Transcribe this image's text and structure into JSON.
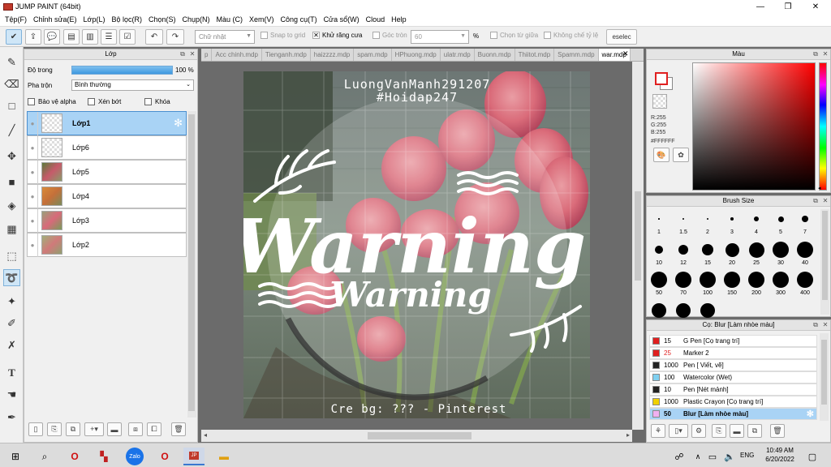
{
  "window": {
    "title": "JUMP PAINT (64bit)"
  },
  "menu": [
    "Tệp(F)",
    "Chỉnh sửa(E)",
    "Lớp(L)",
    "Bộ lọc(R)",
    "Chọn(S)",
    "Chụp(N)",
    "Màu (C)",
    "Xem(V)",
    "Công cụ(T)",
    "Cửa sổ(W)",
    "Cloud",
    "Help"
  ],
  "toolbar": {
    "shape_select": "Chữ nhật",
    "snap_grid": "Snap to grid",
    "antialias": "Khử răng cưa",
    "corner_label": "Góc tròn",
    "corner_value": "60",
    "percent": "%",
    "select_center": "Chọn từ giữa",
    "lock_ratio": "Không chế tỷ lệ",
    "deselect": "eselec"
  },
  "layers": {
    "title": "Lớp",
    "opacity_label": "Độ trong",
    "opacity_value": "100 %",
    "opacity": 1.0,
    "blend_label": "Pha trộn",
    "blend_value": "Bình thường",
    "protect_alpha": "Bảo vệ alpha",
    "clip": "Xén bớt",
    "lock": "Khóa",
    "items": [
      {
        "name": "Lớp1",
        "selected": true
      },
      {
        "name": "Lớp6",
        "selected": false
      },
      {
        "name": "Lớp5",
        "selected": false
      },
      {
        "name": "Lớp4",
        "selected": false
      },
      {
        "name": "Lớp3",
        "selected": false
      },
      {
        "name": "Lớp2",
        "selected": false
      }
    ]
  },
  "tabs": [
    "p",
    "Acc chinh.mdp",
    "Tienganh.mdp",
    "haizzzz.mdp",
    "spam.mdp",
    "HPhuong.mdp",
    "ulatr.mdp",
    "Buonn.mdp",
    "Thiitot.mdp",
    "Spamm.mdp",
    "war.mdp"
  ],
  "artwork": {
    "line1": "LuongVanManh291207",
    "line2": "#Hoidap247",
    "big": "Warning",
    "small": "Warning",
    "credit": "Cre bg: ??? - Pinterest"
  },
  "color": {
    "title": "Màu",
    "r": "R:255",
    "g": "G:255",
    "b": "B:255",
    "hex": "#FFFFFF",
    "fg": "#ffffff",
    "bg": "#ffffff",
    "accent": "#e02020"
  },
  "brush_size": {
    "title": "Brush Size",
    "sizes": [
      "1",
      "1.5",
      "2",
      "3",
      "4",
      "5",
      "7",
      "10",
      "12",
      "15",
      "20",
      "25",
      "30",
      "40",
      "50",
      "70",
      "100",
      "150",
      "200",
      "300",
      "400",
      "",
      "",
      ""
    ]
  },
  "tool_options": {
    "title": "Cọ: Blur [Làm nhòe màu]",
    "brushes": [
      {
        "size": "15",
        "name": "G Pen [Cọ trang trí]",
        "color": "#e02020",
        "size_red": false,
        "selected": false
      },
      {
        "size": "25",
        "name": "Marker 2",
        "color": "#e02020",
        "size_red": true,
        "selected": false
      },
      {
        "size": "1000",
        "name": "Pen [ Viết, vẽ]",
        "color": "#222222",
        "size_red": false,
        "selected": false
      },
      {
        "size": "100",
        "name": "Watercolor (Wet)",
        "color": "#7fd0f0",
        "size_red": false,
        "selected": false
      },
      {
        "size": "10",
        "name": "Pen [Nét mảnh]",
        "color": "#222222",
        "size_red": false,
        "selected": false
      },
      {
        "size": "1000",
        "name": "Plastic Crayon [Cọ trang trí]",
        "color": "#f0d000",
        "size_red": false,
        "selected": false
      },
      {
        "size": "50",
        "name": "Blur [Làm nhòe màu]",
        "color": "#f0b0f0",
        "size_red": false,
        "selected": true
      }
    ]
  },
  "taskbar": {
    "time": "10:49 AM",
    "date": "6/20/2022",
    "lang": "ENG"
  }
}
